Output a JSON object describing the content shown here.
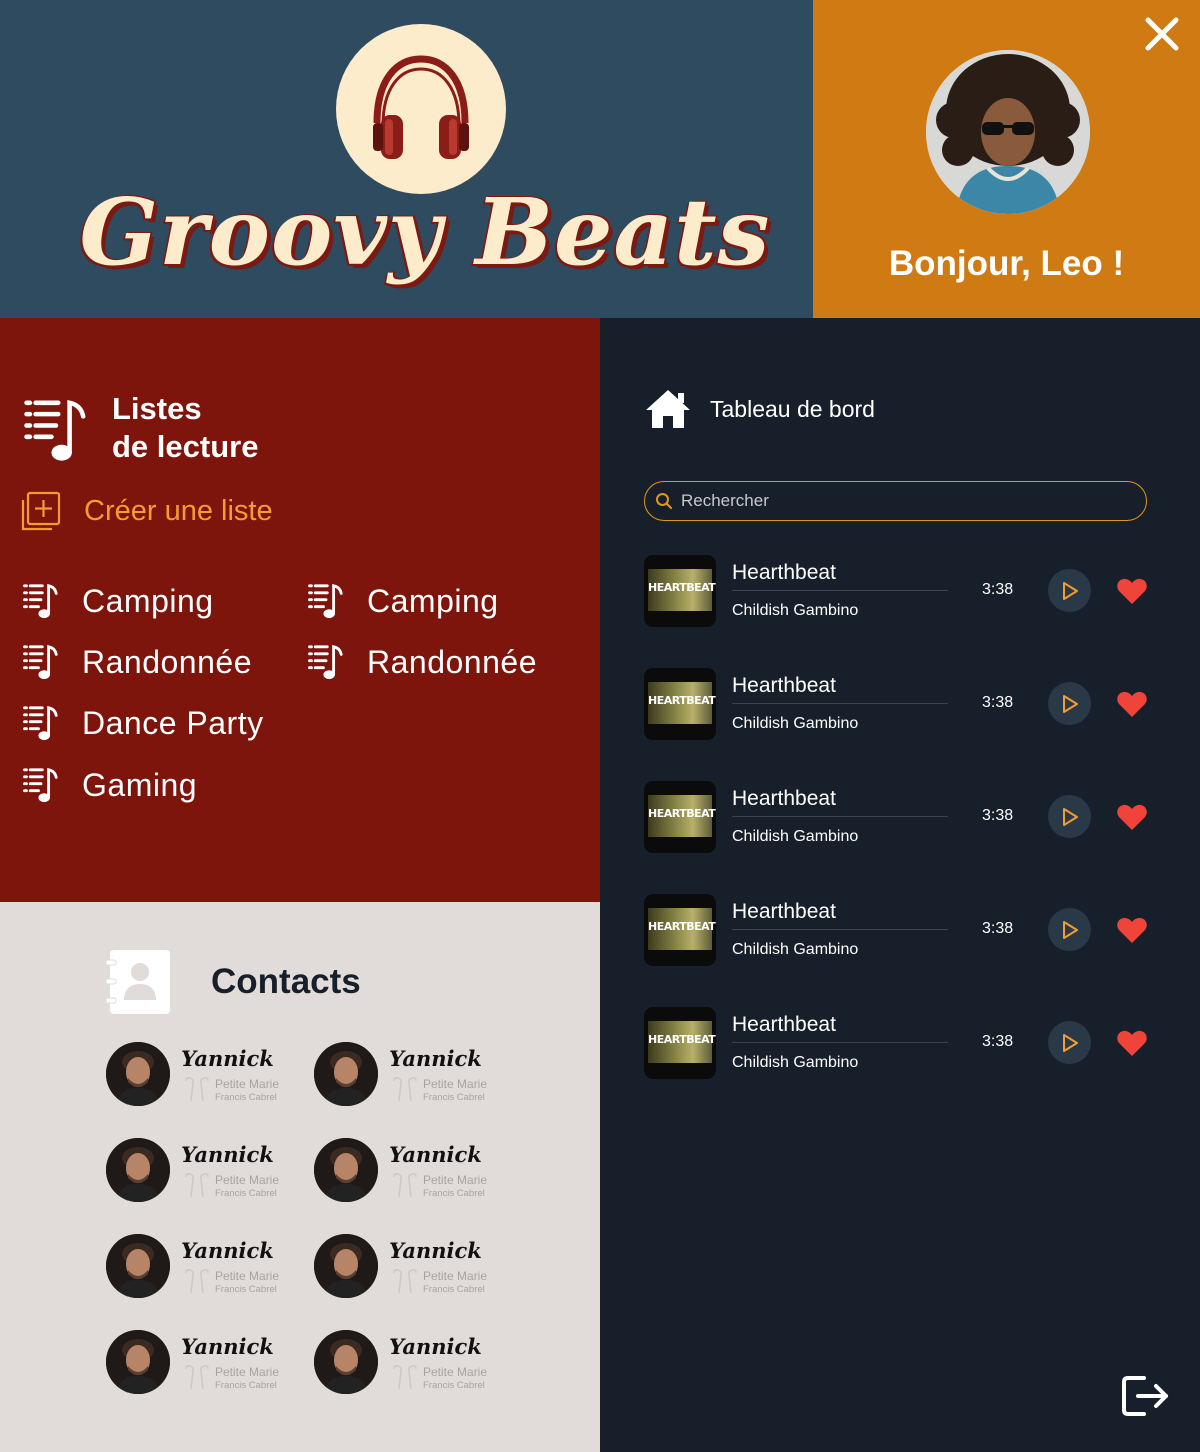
{
  "brand": {
    "title": "Groovy Beats"
  },
  "user": {
    "greeting": "Bonjour, Leo !"
  },
  "playlists": {
    "title_line1": "Listes",
    "title_line2": "de lecture",
    "create_label": "Créer une liste",
    "items": [
      {
        "label": "Camping"
      },
      {
        "label": "Randonnée"
      },
      {
        "label": "Dance Party"
      },
      {
        "label": "Gaming"
      },
      {
        "label": "Camping"
      },
      {
        "label": "Randonnée"
      }
    ]
  },
  "contacts": {
    "title": "Contacts",
    "items": [
      {
        "name": "Yannick",
        "song": "Petite Marie",
        "artist": "Francis Cabrel"
      },
      {
        "name": "Yannick",
        "song": "Petite Marie",
        "artist": "Francis Cabrel"
      },
      {
        "name": "Yannick",
        "song": "Petite Marie",
        "artist": "Francis Cabrel"
      },
      {
        "name": "Yannick",
        "song": "Petite Marie",
        "artist": "Francis Cabrel"
      },
      {
        "name": "Yannick",
        "song": "Petite Marie",
        "artist": "Francis Cabrel"
      },
      {
        "name": "Yannick",
        "song": "Petite Marie",
        "artist": "Francis Cabrel"
      },
      {
        "name": "Yannick",
        "song": "Petite Marie",
        "artist": "Francis Cabrel"
      },
      {
        "name": "Yannick",
        "song": "Petite Marie",
        "artist": "Francis Cabrel"
      }
    ]
  },
  "dashboard": {
    "label": "Tableau de bord"
  },
  "search": {
    "placeholder": "Rechercher"
  },
  "tracks": [
    {
      "title": "Hearthbeat",
      "artist": "Childish Gambino",
      "duration": "3:38",
      "cover_text": "HEARTBEAT"
    },
    {
      "title": "Hearthbeat",
      "artist": "Childish Gambino",
      "duration": "3:38",
      "cover_text": "HEARTBEAT"
    },
    {
      "title": "Hearthbeat",
      "artist": "Childish Gambino",
      "duration": "3:38",
      "cover_text": "HEARTBEAT"
    },
    {
      "title": "Hearthbeat",
      "artist": "Childish Gambino",
      "duration": "3:38",
      "cover_text": "HEARTBEAT"
    },
    {
      "title": "Hearthbeat",
      "artist": "Childish Gambino",
      "duration": "3:38",
      "cover_text": "HEARTBEAT"
    }
  ],
  "icons": {
    "logo": "headphones-icon",
    "close": "close-icon",
    "playlist": "playlist-music-icon",
    "create": "add-playlist-icon",
    "contacts": "contact-book-icon",
    "dashboard": "home-icon",
    "search": "search-icon",
    "play": "play-icon",
    "favorite": "heart-icon",
    "logout": "logout-icon",
    "earphones": "earphones-icon"
  },
  "colors": {
    "header_bg": "#2f4b5f",
    "user_bg": "#d07a13",
    "playlists_bg": "#7e150c",
    "contacts_bg": "#e1dcda",
    "main_bg": "#17202a",
    "accent": "#f39c32",
    "heart": "#f0443a",
    "logo_cream": "#fdeccb",
    "logo_red": "#8b1c17"
  }
}
